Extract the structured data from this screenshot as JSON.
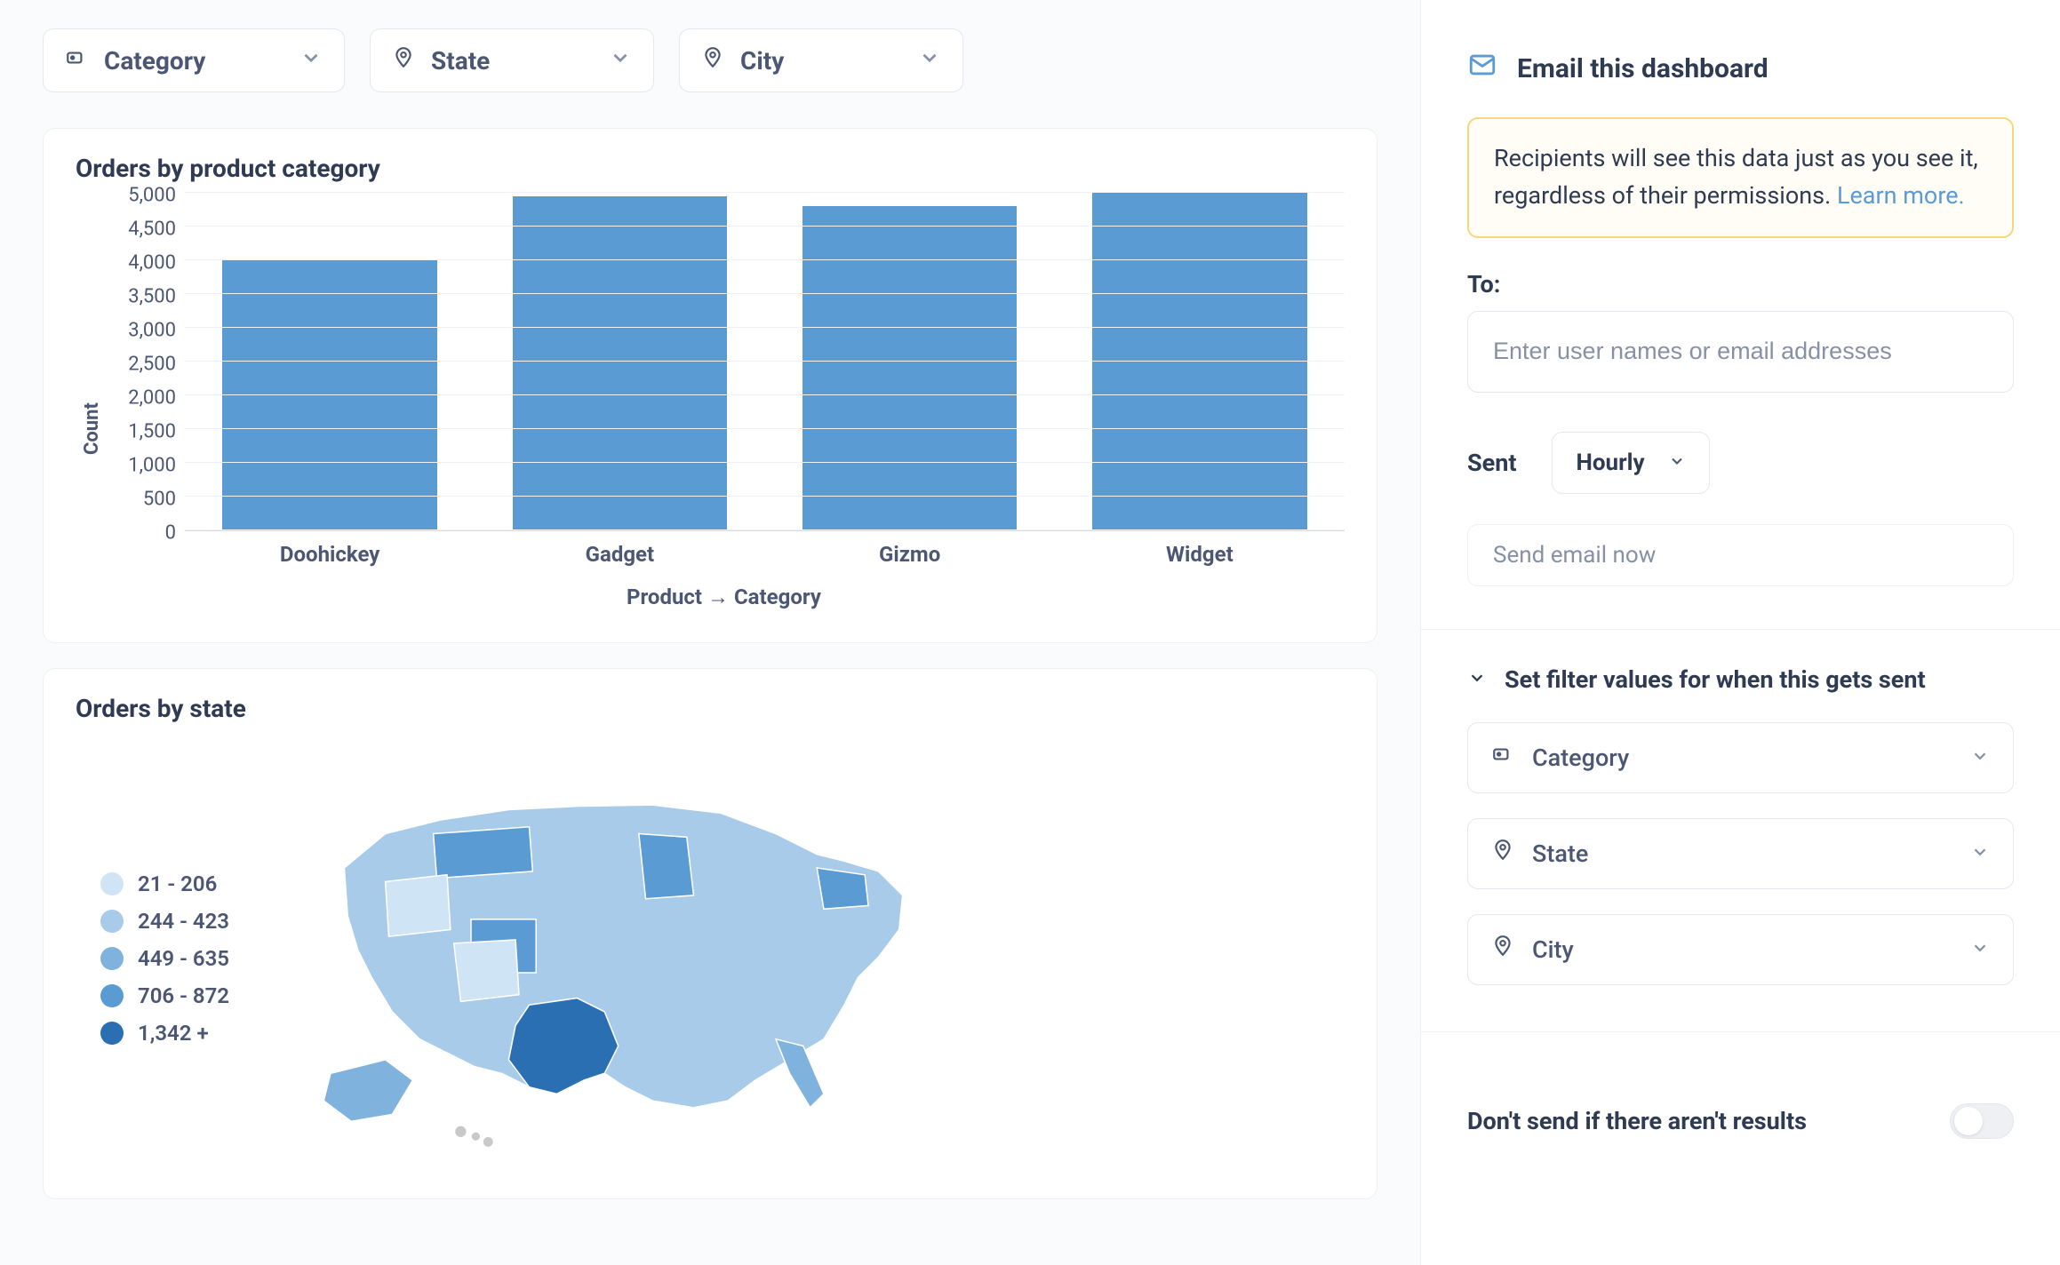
{
  "filters": {
    "top": [
      {
        "label": "Category",
        "icon": "tag-icon"
      },
      {
        "label": "State",
        "icon": "pin-icon"
      },
      {
        "label": "City",
        "icon": "pin-icon"
      }
    ]
  },
  "cards": {
    "orders_by_category": {
      "title": "Orders by product category"
    },
    "orders_by_state": {
      "title": "Orders by state"
    }
  },
  "chart_data": {
    "type": "bar",
    "categories": [
      "Doohickey",
      "Gadget",
      "Gizmo",
      "Widget"
    ],
    "values": [
      4000,
      4950,
      4800,
      5050
    ],
    "title": "Orders by product category",
    "ylabel": "Count",
    "xlabel": "Product → Category",
    "ylim": [
      0,
      5000
    ],
    "yticks": [
      0,
      500,
      1000,
      1500,
      2000,
      2500,
      3000,
      3500,
      4000,
      4500,
      5000
    ],
    "ytick_labels": [
      "0",
      "500",
      "1,000",
      "1,500",
      "2,000",
      "2,500",
      "3,000",
      "3,500",
      "4,000",
      "4,500",
      "5,000"
    ]
  },
  "map_legend": {
    "items": [
      {
        "label": "21 - 206",
        "color": "#cfe4f4"
      },
      {
        "label": "244 - 423",
        "color": "#a7cbe9"
      },
      {
        "label": "449 - 635",
        "color": "#7fb3de"
      },
      {
        "label": "706 - 872",
        "color": "#5a9bd4"
      },
      {
        "label": "1,342 +",
        "color": "#2b6fb3"
      }
    ]
  },
  "sidebar": {
    "title": "Email this dashboard",
    "notice_text": "Recipients will see this data just as you see it, regardless of their permissions. ",
    "notice_link": "Learn more.",
    "to_label": "To:",
    "to_placeholder": "Enter user names or email addresses",
    "sent_label": "Sent",
    "sent_value": "Hourly",
    "send_now": "Send email now",
    "filter_section_title": "Set filter values for when this gets sent",
    "filters": [
      {
        "label": "Category",
        "icon": "tag-icon"
      },
      {
        "label": "State",
        "icon": "pin-icon"
      },
      {
        "label": "City",
        "icon": "pin-icon"
      }
    ],
    "dont_send_label": "Don't send if there aren't results"
  }
}
